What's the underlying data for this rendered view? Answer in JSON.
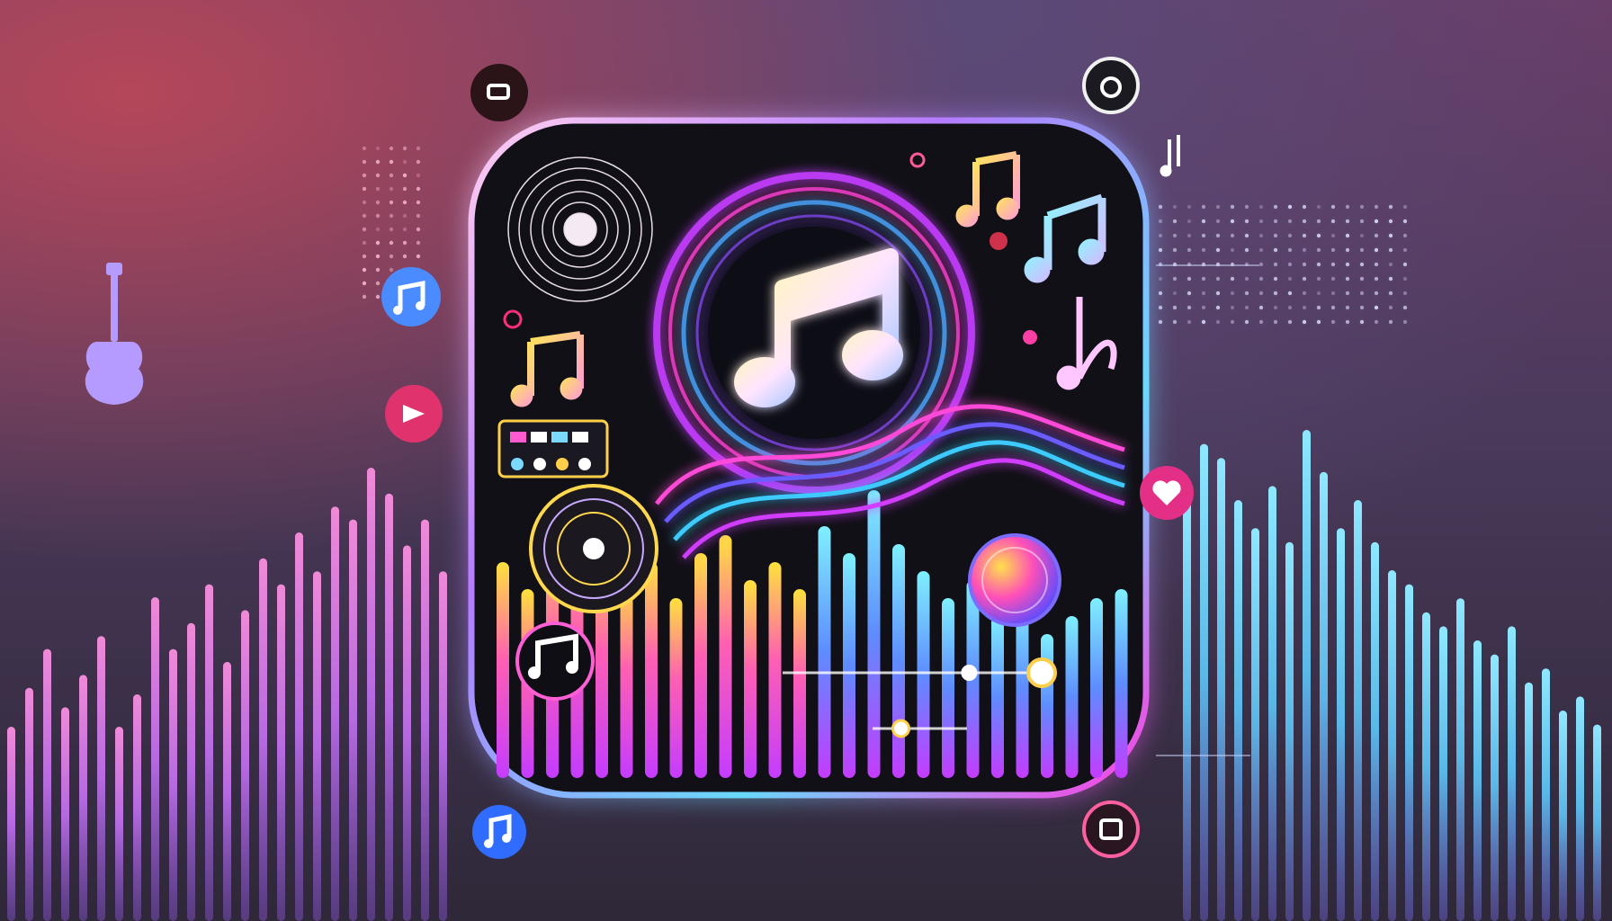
{
  "colors": {
    "bg_top": "#6a3e68",
    "bg_bottom": "#2e2838",
    "panel_bg": "#121016",
    "neon_pink": "#ff2bd6",
    "neon_purple": "#9b3cff",
    "neon_cyan": "#5fe3ff",
    "neon_yellow": "#ffd23c",
    "bar_left": "#c86be0",
    "bar_right": "#5fc9e8"
  },
  "icons": {
    "app_logo": "music-note-icon",
    "vinyl": "vinyl-record-icon",
    "guitar": "guitar-icon",
    "heart": "heart-icon",
    "equalizer": "equalizer-icon",
    "slider": "slider-icon"
  },
  "levels": {
    "slider_1": 0.72,
    "slider_2": 0.3
  }
}
